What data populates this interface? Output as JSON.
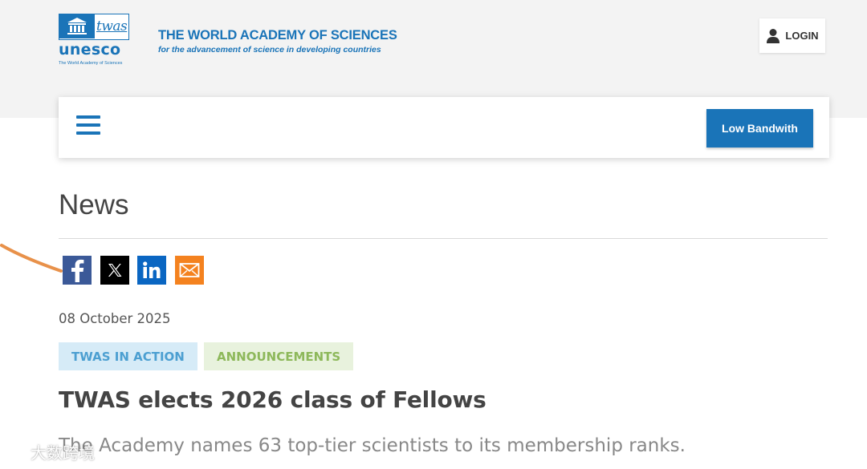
{
  "header": {
    "logo": {
      "box_word": "twas",
      "wordmark": "unesco",
      "sub_text": "The World Academy of Sciences"
    },
    "org_title": "THE WORLD ACADEMY OF SCIENCES",
    "org_tagline": "for the advancement of science in developing countries",
    "login_label": "LOGIN",
    "login_icon": "user-icon"
  },
  "nav": {
    "menu_icon": "hamburger-menu-icon",
    "low_bandwidth_label": "Low Bandwith"
  },
  "main": {
    "heading": "News",
    "share": [
      {
        "name": "facebook",
        "icon": "facebook-icon"
      },
      {
        "name": "x",
        "icon": "x-icon"
      },
      {
        "name": "linkedin",
        "icon": "linkedin-icon"
      },
      {
        "name": "email",
        "icon": "email-icon"
      }
    ],
    "date": "08 October 2025",
    "tags": [
      "TWAS IN ACTION",
      "ANNOUNCEMENTS"
    ],
    "title": "TWAS elects 2026 class of Fellows",
    "summary": "The Academy names 63 top-tier scientists to its membership ranks."
  },
  "watermark": "大数跨境",
  "colors": {
    "brand_blue": "#1a74b8",
    "facebook": "#3b5998",
    "x": "#000000",
    "linkedin": "#0a66c2",
    "email": "#f4821f",
    "tag_twas_bg": "#d6ebf7",
    "tag_twas_text": "#4c9fd1",
    "tag_announcements_bg": "#e8f2dd",
    "tag_announcements_text": "#8db85a",
    "annotation_stroke": "#e8914a"
  }
}
